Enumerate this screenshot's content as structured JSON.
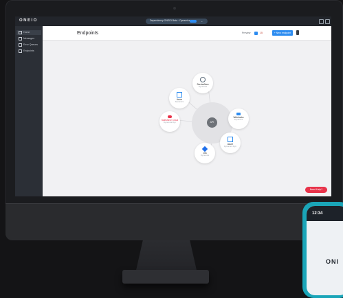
{
  "app": {
    "logo": "ONEIO"
  },
  "topbar": {
    "dashboard_title": "Dependency ONEIO Beta · Dynamics",
    "badge": "NEW",
    "chevron": "⌄"
  },
  "sidebar": {
    "items": [
      {
        "label": "Home",
        "active": true
      },
      {
        "label": "Messages",
        "active": false
      },
      {
        "label": "Error Queues",
        "active": false
      },
      {
        "label": "Endpoints",
        "active": false
      }
    ]
  },
  "page": {
    "title": "Endpoints"
  },
  "header": {
    "preview_label": "Preview",
    "count": "15",
    "new_button": "+ New endpoint"
  },
  "diagram": {
    "hub_label": "API",
    "nodes": [
      {
        "key": "top",
        "label": "ServiceNow",
        "sub": "Dynamics",
        "icon": "servicenow-icon",
        "color": "#5a6a7a"
      },
      {
        "key": "upper-left",
        "label": "Azure",
        "sub": "Dynamics",
        "icon": "azure-icon",
        "color": "#2d8cf0"
      },
      {
        "key": "left",
        "label": "Salesforce Cloud",
        "sub": "Dynamics Dyn",
        "icon": "salesforce-icon",
        "color": "#e8334a"
      },
      {
        "key": "right",
        "label": "Webhooks",
        "sub": "Dynamics",
        "icon": "webhook-icon",
        "color": "#2d8cf0"
      },
      {
        "key": "lower-right",
        "label": "Azure",
        "sub": "Dynamics Dyn",
        "icon": "azure-icon",
        "color": "#2d8cf0"
      },
      {
        "key": "bottom",
        "label": "Jira",
        "sub": "Dynamics",
        "icon": "jira-icon",
        "color": "#1f6feb"
      }
    ]
  },
  "help": {
    "label": "Need Help?"
  },
  "phone": {
    "time": "12:34",
    "logo": "ONI"
  }
}
